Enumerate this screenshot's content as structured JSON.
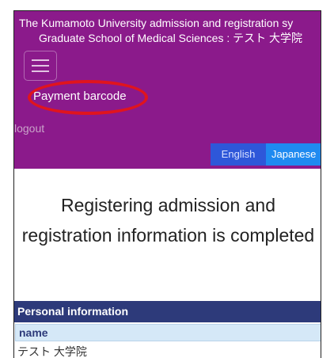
{
  "header": {
    "title_line1": "The Kumamoto University admission and registration sy",
    "title_line2": "Graduate School of Medical Sciences : テスト 大学院",
    "background_color": "#8b1a8b"
  },
  "nav": {
    "menu_icon": "hamburger-menu-icon",
    "payment_barcode_label": "Payment barcode",
    "logout_label": "logout"
  },
  "language": {
    "english_label": "English",
    "japanese_label": "Japanese",
    "selected": "Japanese"
  },
  "main": {
    "heading": "Registering admission and registration information is completed"
  },
  "personal_info": {
    "section_title": "Personal information",
    "field_label": "name",
    "field_value": "テスト 大学院"
  },
  "annotation": {
    "highlight_color": "#e0141e"
  }
}
